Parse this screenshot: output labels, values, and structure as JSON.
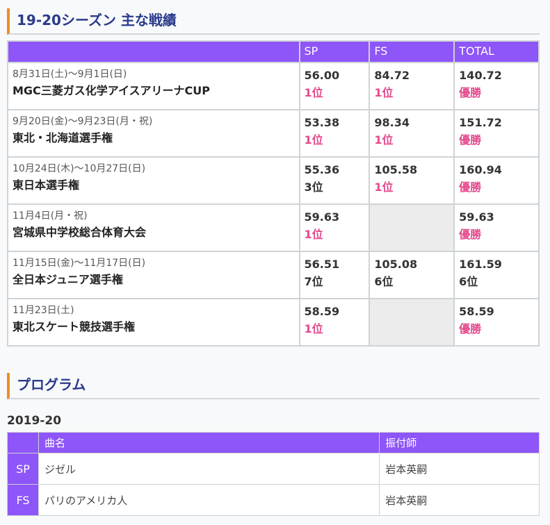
{
  "results": {
    "heading": "19-20シーズン 主な戦績",
    "columns": {
      "event": "",
      "sp": "SP",
      "fs": "FS",
      "total": "TOTAL"
    },
    "rows": [
      {
        "date": "8月31日(土)～9月1日(日)",
        "name": "MGC三菱ガス化学アイスアリーナCUP",
        "sp_score": "56.00",
        "sp_rank": "1位",
        "fs_score": "84.72",
        "fs_rank": "1位",
        "total_score": "140.72",
        "total_rank": "優勝"
      },
      {
        "date": "9月20日(金)～9月23日(月・祝)",
        "name": "東北・北海道選手権",
        "sp_score": "53.38",
        "sp_rank": "1位",
        "fs_score": "98.34",
        "fs_rank": "1位",
        "total_score": "151.72",
        "total_rank": "優勝"
      },
      {
        "date": "10月24日(木)～10月27日(日)",
        "name": "東日本選手権",
        "sp_score": "55.36",
        "sp_rank": "3位",
        "fs_score": "105.58",
        "fs_rank": "1位",
        "total_score": "160.94",
        "total_rank": "優勝"
      },
      {
        "date": "11月4日(月・祝)",
        "name": "宮城県中学校総合体育大会",
        "sp_score": "59.63",
        "sp_rank": "1位",
        "fs_score": "",
        "fs_rank": "",
        "total_score": "59.63",
        "total_rank": "優勝"
      },
      {
        "date": "11月15日(金)～11月17日(日)",
        "name": "全日本ジュニア選手権",
        "sp_score": "56.51",
        "sp_rank": "7位",
        "fs_score": "105.08",
        "fs_rank": "6位",
        "total_score": "161.59",
        "total_rank": "6位"
      },
      {
        "date": "11月23日(土)",
        "name": "東北スケート競技選手権",
        "sp_score": "58.59",
        "sp_rank": "1位",
        "fs_score": "",
        "fs_rank": "",
        "total_score": "58.59",
        "total_rank": "優勝"
      }
    ]
  },
  "program": {
    "heading": "プログラム",
    "season": "2019-20",
    "columns": {
      "blank": "",
      "music": "曲名",
      "choreographer": "振付師"
    },
    "rows": [
      {
        "type": "SP",
        "music": "ジゼル",
        "choreographer": "岩本英嗣"
      },
      {
        "type": "FS",
        "music": "パリのアメリカ人",
        "choreographer": "岩本英嗣"
      }
    ]
  },
  "colors": {
    "accent_purple": "#8e55f8",
    "heading_blue": "#2a3a8c",
    "heading_bar_orange": "#f08a24",
    "rank_pink": "#e5498d"
  }
}
